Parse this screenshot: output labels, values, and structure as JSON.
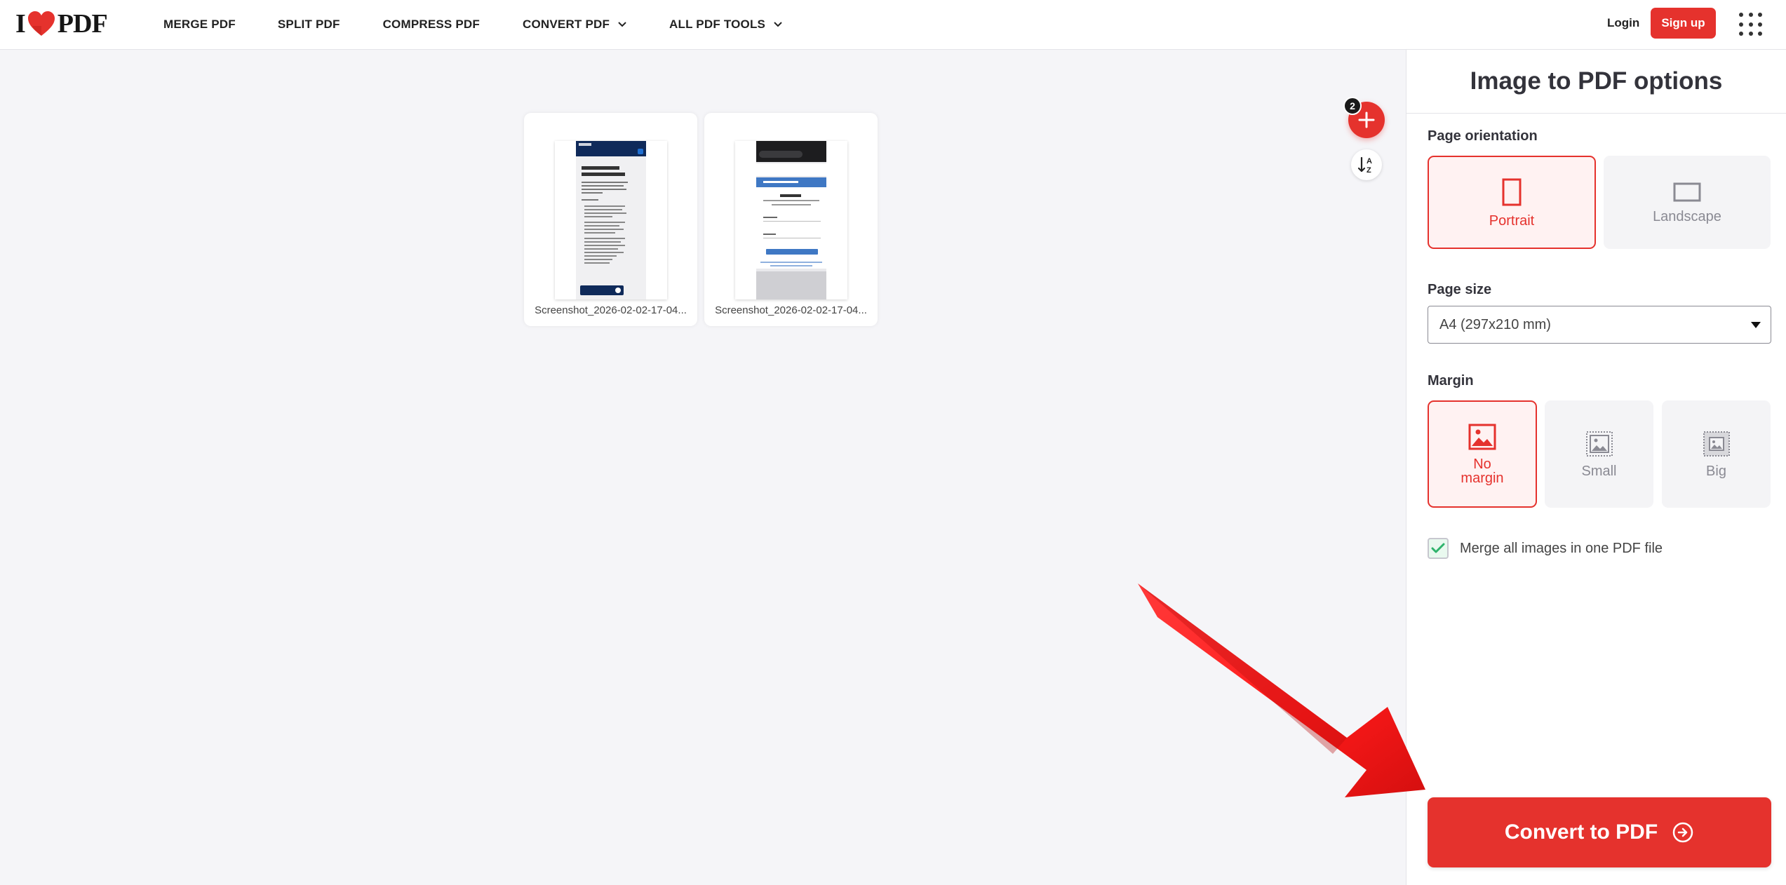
{
  "header": {
    "logo": {
      "left": "I",
      "right": "PDF"
    },
    "nav": [
      {
        "label": "MERGE PDF",
        "dropdown": false
      },
      {
        "label": "SPLIT PDF",
        "dropdown": false
      },
      {
        "label": "COMPRESS PDF",
        "dropdown": false
      },
      {
        "label": "CONVERT PDF",
        "dropdown": true
      },
      {
        "label": "ALL PDF TOOLS",
        "dropdown": true
      }
    ],
    "login_label": "Login",
    "signup_label": "Sign up",
    "apps_icon": "apps-grid-icon"
  },
  "workspace": {
    "file_count": "2",
    "files": [
      {
        "name": "Screenshot_2026-02-02-17-04...",
        "thumb_icon": "phone-screenshot-thumbnail"
      },
      {
        "name": "Screenshot_2026-02-02-17-04...",
        "thumb_icon": "phone-screenshot-thumbnail"
      }
    ],
    "add_icon": "plus-icon",
    "sort_icon": "sort-az-icon"
  },
  "sidebar": {
    "title": "Image to PDF options",
    "orientation": {
      "label": "Page orientation",
      "options": [
        {
          "label": "Portrait",
          "icon": "portrait-icon",
          "selected": true
        },
        {
          "label": "Landscape",
          "icon": "landscape-icon",
          "selected": false
        }
      ]
    },
    "page_size": {
      "label": "Page size",
      "value": "A4 (297x210 mm)"
    },
    "margin": {
      "label": "Margin",
      "options": [
        {
          "label": "No margin",
          "icon": "image-icon",
          "selected": true
        },
        {
          "label": "Small",
          "icon": "image-small-margin-icon",
          "selected": false
        },
        {
          "label": "Big",
          "icon": "image-big-margin-icon",
          "selected": false
        }
      ]
    },
    "merge": {
      "label": "Merge all images in one PDF file",
      "checked": true
    },
    "convert_label": "Convert to PDF"
  },
  "colors": {
    "brand_red": "#e5322d",
    "check_green": "#2fb36c",
    "annotation_red": "#ff1a1a"
  }
}
